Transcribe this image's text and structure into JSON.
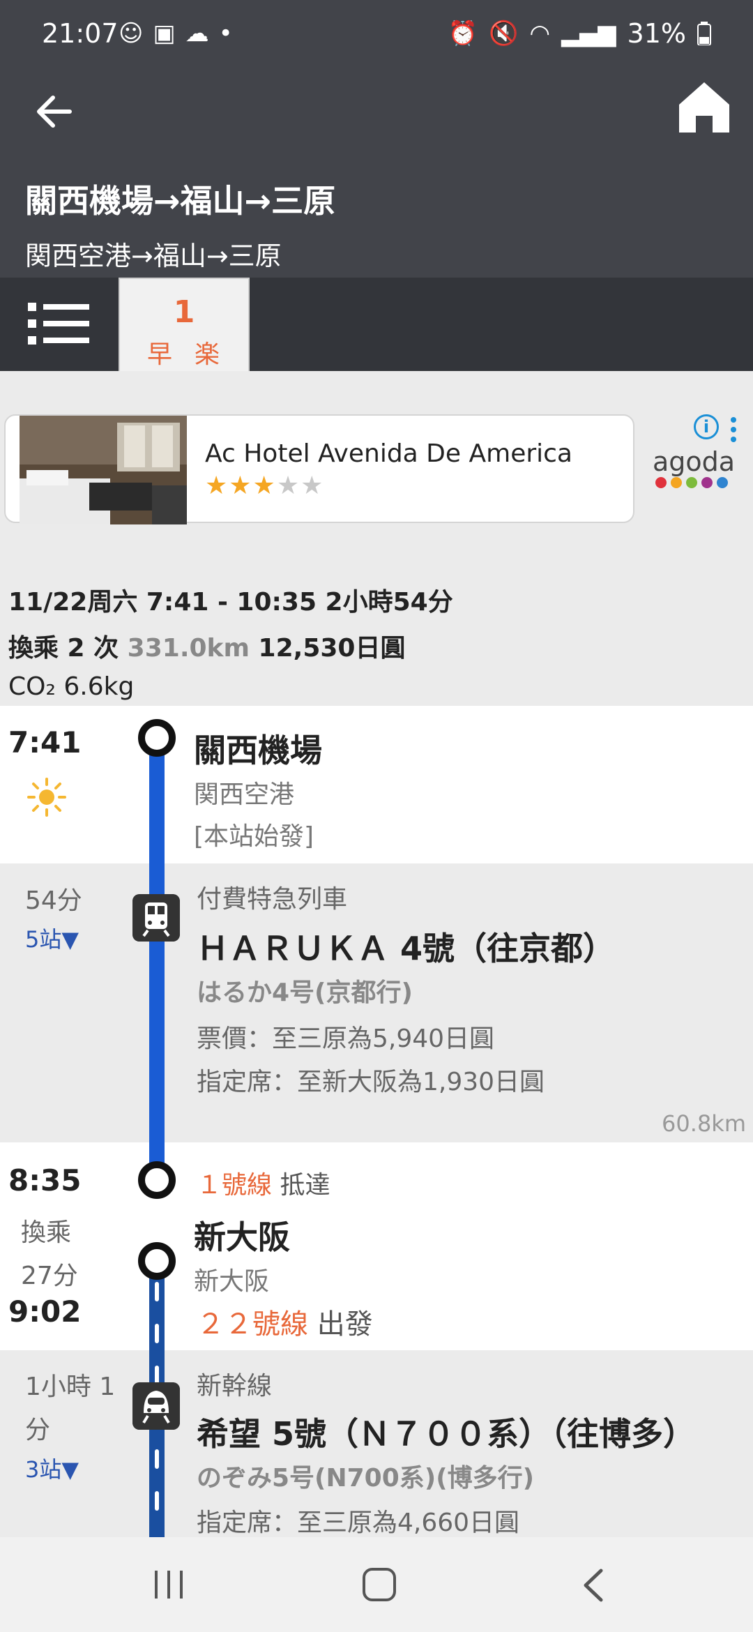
{
  "status_bar": {
    "time": "21:07",
    "battery": "31%"
  },
  "header": {
    "title": "關西機場→福山→三原",
    "subtitle": "関西空港→福山→三原"
  },
  "tabs": {
    "selected_number": "1",
    "selected_label": "早楽"
  },
  "ad": {
    "hotel_name": "Ac Hotel Avenida De America",
    "stars_on": "★★★",
    "stars_off": "★★",
    "brand": "agoda",
    "info_icon": "i"
  },
  "summary": {
    "line1": "11/22周六 7:41 - 10:35 2小時54分",
    "transfers": "換乘 2 次",
    "distance": "331.0km",
    "fare": "12,530日圓",
    "co2": "CO₂ 6.6kg"
  },
  "leg1": {
    "dep_time": "7:41",
    "station": "關西機場",
    "station_jp": "関西空港",
    "note": "[本站始發]",
    "duration": "54分",
    "stops": "5站▼",
    "category": "付費特急列車",
    "train": "ＨＡＲＵＫＡ 4號（往京都）",
    "train_jp": "はるか4号(京都行)",
    "fare": "票價：至三原為5,940日圓",
    "reserved": "指定席：至新大阪為1,930日圓",
    "distance": "60.8km"
  },
  "transfer1": {
    "arr_time": "8:35",
    "label": "換乘",
    "wait": "27分",
    "dep_time": "9:02",
    "arr_platform": "１號線",
    "arr_word": "抵達",
    "station": "新大阪",
    "station_jp": "新大阪",
    "dep_platform": "２２號線",
    "dep_word": "出發"
  },
  "leg2": {
    "duration": "1小時 1分",
    "stops": "3站▼",
    "category": "新幹線",
    "train": "希望 5號（Ｎ７００系）（往博多）",
    "train_jp": "のぞみ5号(N700系)(博多行)",
    "reserved": "指定席：至三原為4,660日圓"
  },
  "colors": {
    "accent": "#e8683a",
    "route_line": "#1a5cd4",
    "header": "#42444a"
  }
}
